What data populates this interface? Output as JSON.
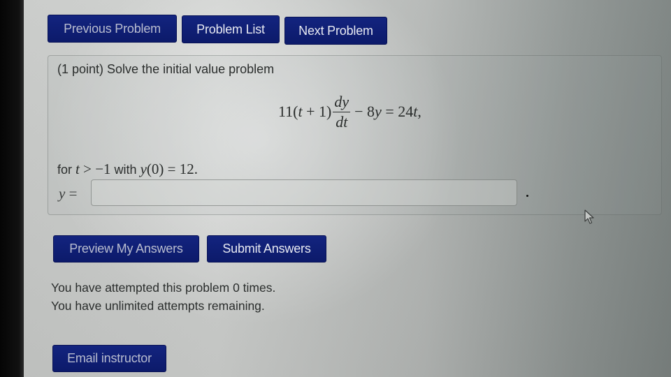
{
  "nav": {
    "previous_label": "Previous Problem",
    "list_label": "Problem List",
    "next_label": "Next Problem"
  },
  "problem": {
    "prompt": "(1 point) Solve the initial value problem",
    "equation": {
      "coef": "11(",
      "var_t": "t",
      "plus_one": " + 1)",
      "numerator": "dy",
      "denominator": "dt",
      "minus_term": "− 8",
      "var_y": "y",
      "rhs": " = 24",
      "rhs_var": "t",
      "trailing": ","
    },
    "condition": {
      "for_text": "for ",
      "t": "t",
      "ineq": " > −1",
      "with_text": " with ",
      "y": "y",
      "init": "(0) = 12."
    },
    "answer": {
      "label_var": "y",
      "label_eq": " =",
      "value": "",
      "placeholder": ""
    }
  },
  "actions": {
    "preview_label": "Preview My Answers",
    "submit_label": "Submit Answers"
  },
  "status": {
    "attempted": "You have attempted this problem 0 times.",
    "remaining": "You have unlimited attempts remaining."
  },
  "footer": {
    "email_label": "Email instructor"
  },
  "colors": {
    "button_bg": "#10207a",
    "button_text": "#e8eaf2",
    "text": "#2a2d2c"
  }
}
